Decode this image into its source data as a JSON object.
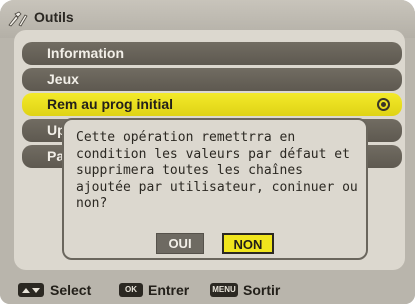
{
  "header": {
    "title": "Outils",
    "icon": "tools-icon"
  },
  "menu": {
    "items": [
      {
        "label": "Information",
        "active": false
      },
      {
        "label": "Jeux",
        "active": false
      },
      {
        "label": "Rem au prog initial",
        "active": true
      },
      {
        "label": "Up",
        "active": false
      },
      {
        "label": "Pa",
        "active": false
      }
    ]
  },
  "dialog": {
    "lines": [
      "Cette opération remettrra en",
      "condition les valeurs par défaut et",
      "supprimera toutes les chaînes",
      "ajoutée par utilisateur, coninuer ou",
      "non?"
    ],
    "buttons": {
      "yes": "OUI",
      "no": "NON",
      "selected": "NON"
    }
  },
  "hints": {
    "select_key": "arrows-key-icon",
    "select": "Select",
    "enter_key": "OK",
    "enter": "Entrer",
    "exit_key": "MENU",
    "exit": "Sortir"
  },
  "colors": {
    "highlight": "#f0e51d",
    "item_bg": "#6a655c",
    "panel_bg": "#dcd8cf",
    "frame_bg": "#b9b5ac"
  }
}
